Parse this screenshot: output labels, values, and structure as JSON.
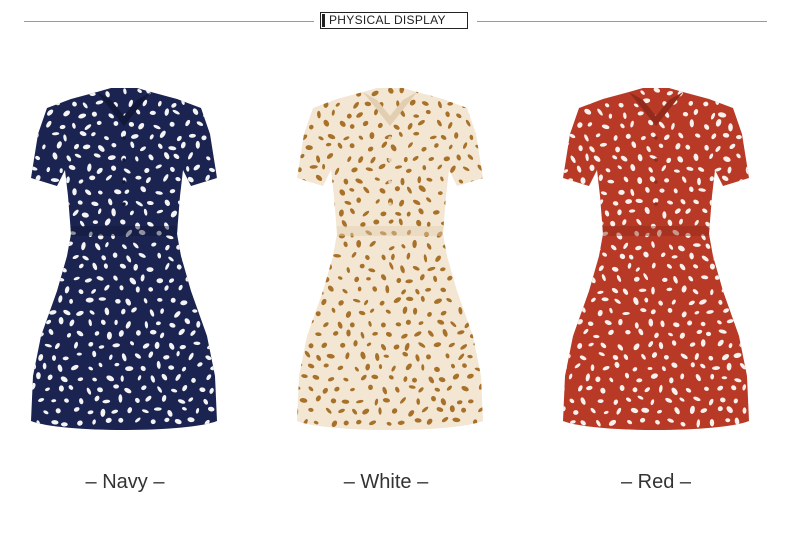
{
  "header": {
    "title": "PHYSICAL DISPLAY"
  },
  "products": [
    {
      "label": "– Navy –",
      "fabric_color": "#1b2450",
      "spot_color": "#f4f4f4",
      "shadow_color": "#11183a"
    },
    {
      "label": "– White –",
      "fabric_color": "#f3e6d2",
      "spot_color": "#a8712a",
      "shadow_color": "#e2cfb2"
    },
    {
      "label": "– Red –",
      "fabric_color": "#b83a26",
      "spot_color": "#f6f1ec",
      "shadow_color": "#922b1b"
    }
  ]
}
